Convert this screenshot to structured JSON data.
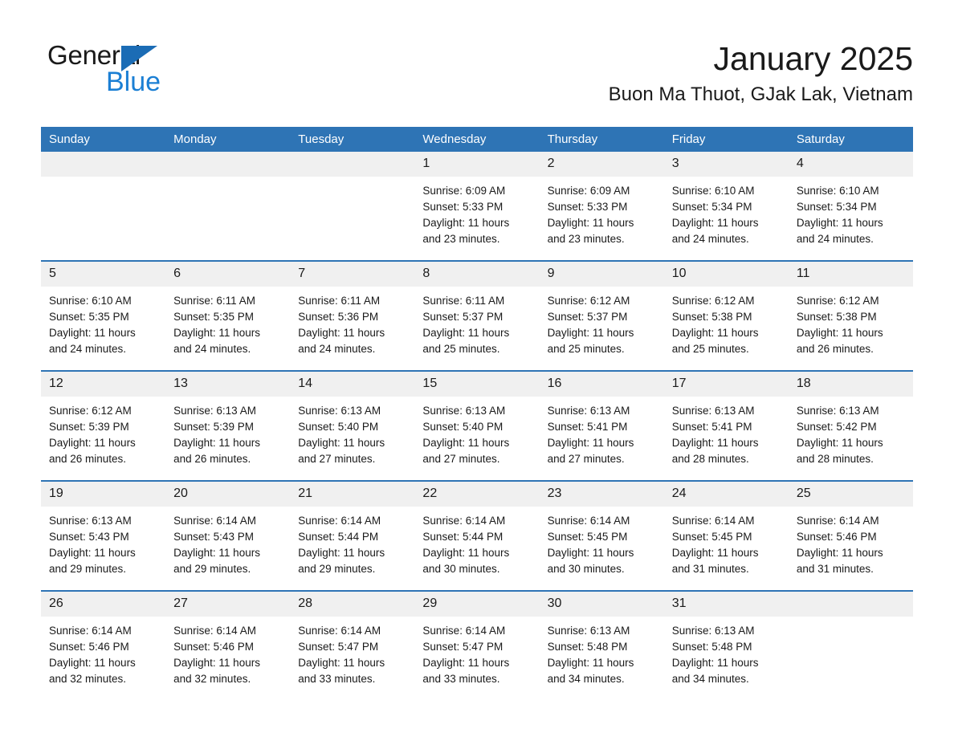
{
  "logo": {
    "word1": "General",
    "word2": "Blue",
    "triangle_color": "#1b6cb5",
    "blue_color": "#1b7fd4"
  },
  "header": {
    "month_year": "January 2025",
    "location": "Buon Ma Thuot, GJak Lak, Vietnam"
  },
  "theme": {
    "header_blue": "#2e74b5",
    "daynum_gray": "#f0f0f0",
    "text": "#1a1a1a"
  },
  "weekdays": [
    "Sunday",
    "Monday",
    "Tuesday",
    "Wednesday",
    "Thursday",
    "Friday",
    "Saturday"
  ],
  "weeks": [
    [
      {
        "day": "",
        "empty": true
      },
      {
        "day": "",
        "empty": true
      },
      {
        "day": "",
        "empty": true
      },
      {
        "day": "1",
        "sunrise": "Sunrise: 6:09 AM",
        "sunset": "Sunset: 5:33 PM",
        "daylight1": "Daylight: 11 hours",
        "daylight2": "and 23 minutes."
      },
      {
        "day": "2",
        "sunrise": "Sunrise: 6:09 AM",
        "sunset": "Sunset: 5:33 PM",
        "daylight1": "Daylight: 11 hours",
        "daylight2": "and 23 minutes."
      },
      {
        "day": "3",
        "sunrise": "Sunrise: 6:10 AM",
        "sunset": "Sunset: 5:34 PM",
        "daylight1": "Daylight: 11 hours",
        "daylight2": "and 24 minutes."
      },
      {
        "day": "4",
        "sunrise": "Sunrise: 6:10 AM",
        "sunset": "Sunset: 5:34 PM",
        "daylight1": "Daylight: 11 hours",
        "daylight2": "and 24 minutes."
      }
    ],
    [
      {
        "day": "5",
        "sunrise": "Sunrise: 6:10 AM",
        "sunset": "Sunset: 5:35 PM",
        "daylight1": "Daylight: 11 hours",
        "daylight2": "and 24 minutes."
      },
      {
        "day": "6",
        "sunrise": "Sunrise: 6:11 AM",
        "sunset": "Sunset: 5:35 PM",
        "daylight1": "Daylight: 11 hours",
        "daylight2": "and 24 minutes."
      },
      {
        "day": "7",
        "sunrise": "Sunrise: 6:11 AM",
        "sunset": "Sunset: 5:36 PM",
        "daylight1": "Daylight: 11 hours",
        "daylight2": "and 24 minutes."
      },
      {
        "day": "8",
        "sunrise": "Sunrise: 6:11 AM",
        "sunset": "Sunset: 5:37 PM",
        "daylight1": "Daylight: 11 hours",
        "daylight2": "and 25 minutes."
      },
      {
        "day": "9",
        "sunrise": "Sunrise: 6:12 AM",
        "sunset": "Sunset: 5:37 PM",
        "daylight1": "Daylight: 11 hours",
        "daylight2": "and 25 minutes."
      },
      {
        "day": "10",
        "sunrise": "Sunrise: 6:12 AM",
        "sunset": "Sunset: 5:38 PM",
        "daylight1": "Daylight: 11 hours",
        "daylight2": "and 25 minutes."
      },
      {
        "day": "11",
        "sunrise": "Sunrise: 6:12 AM",
        "sunset": "Sunset: 5:38 PM",
        "daylight1": "Daylight: 11 hours",
        "daylight2": "and 26 minutes."
      }
    ],
    [
      {
        "day": "12",
        "sunrise": "Sunrise: 6:12 AM",
        "sunset": "Sunset: 5:39 PM",
        "daylight1": "Daylight: 11 hours",
        "daylight2": "and 26 minutes."
      },
      {
        "day": "13",
        "sunrise": "Sunrise: 6:13 AM",
        "sunset": "Sunset: 5:39 PM",
        "daylight1": "Daylight: 11 hours",
        "daylight2": "and 26 minutes."
      },
      {
        "day": "14",
        "sunrise": "Sunrise: 6:13 AM",
        "sunset": "Sunset: 5:40 PM",
        "daylight1": "Daylight: 11 hours",
        "daylight2": "and 27 minutes."
      },
      {
        "day": "15",
        "sunrise": "Sunrise: 6:13 AM",
        "sunset": "Sunset: 5:40 PM",
        "daylight1": "Daylight: 11 hours",
        "daylight2": "and 27 minutes."
      },
      {
        "day": "16",
        "sunrise": "Sunrise: 6:13 AM",
        "sunset": "Sunset: 5:41 PM",
        "daylight1": "Daylight: 11 hours",
        "daylight2": "and 27 minutes."
      },
      {
        "day": "17",
        "sunrise": "Sunrise: 6:13 AM",
        "sunset": "Sunset: 5:41 PM",
        "daylight1": "Daylight: 11 hours",
        "daylight2": "and 28 minutes."
      },
      {
        "day": "18",
        "sunrise": "Sunrise: 6:13 AM",
        "sunset": "Sunset: 5:42 PM",
        "daylight1": "Daylight: 11 hours",
        "daylight2": "and 28 minutes."
      }
    ],
    [
      {
        "day": "19",
        "sunrise": "Sunrise: 6:13 AM",
        "sunset": "Sunset: 5:43 PM",
        "daylight1": "Daylight: 11 hours",
        "daylight2": "and 29 minutes."
      },
      {
        "day": "20",
        "sunrise": "Sunrise: 6:14 AM",
        "sunset": "Sunset: 5:43 PM",
        "daylight1": "Daylight: 11 hours",
        "daylight2": "and 29 minutes."
      },
      {
        "day": "21",
        "sunrise": "Sunrise: 6:14 AM",
        "sunset": "Sunset: 5:44 PM",
        "daylight1": "Daylight: 11 hours",
        "daylight2": "and 29 minutes."
      },
      {
        "day": "22",
        "sunrise": "Sunrise: 6:14 AM",
        "sunset": "Sunset: 5:44 PM",
        "daylight1": "Daylight: 11 hours",
        "daylight2": "and 30 minutes."
      },
      {
        "day": "23",
        "sunrise": "Sunrise: 6:14 AM",
        "sunset": "Sunset: 5:45 PM",
        "daylight1": "Daylight: 11 hours",
        "daylight2": "and 30 minutes."
      },
      {
        "day": "24",
        "sunrise": "Sunrise: 6:14 AM",
        "sunset": "Sunset: 5:45 PM",
        "daylight1": "Daylight: 11 hours",
        "daylight2": "and 31 minutes."
      },
      {
        "day": "25",
        "sunrise": "Sunrise: 6:14 AM",
        "sunset": "Sunset: 5:46 PM",
        "daylight1": "Daylight: 11 hours",
        "daylight2": "and 31 minutes."
      }
    ],
    [
      {
        "day": "26",
        "sunrise": "Sunrise: 6:14 AM",
        "sunset": "Sunset: 5:46 PM",
        "daylight1": "Daylight: 11 hours",
        "daylight2": "and 32 minutes."
      },
      {
        "day": "27",
        "sunrise": "Sunrise: 6:14 AM",
        "sunset": "Sunset: 5:46 PM",
        "daylight1": "Daylight: 11 hours",
        "daylight2": "and 32 minutes."
      },
      {
        "day": "28",
        "sunrise": "Sunrise: 6:14 AM",
        "sunset": "Sunset: 5:47 PM",
        "daylight1": "Daylight: 11 hours",
        "daylight2": "and 33 minutes."
      },
      {
        "day": "29",
        "sunrise": "Sunrise: 6:14 AM",
        "sunset": "Sunset: 5:47 PM",
        "daylight1": "Daylight: 11 hours",
        "daylight2": "and 33 minutes."
      },
      {
        "day": "30",
        "sunrise": "Sunrise: 6:13 AM",
        "sunset": "Sunset: 5:48 PM",
        "daylight1": "Daylight: 11 hours",
        "daylight2": "and 34 minutes."
      },
      {
        "day": "31",
        "sunrise": "Sunrise: 6:13 AM",
        "sunset": "Sunset: 5:48 PM",
        "daylight1": "Daylight: 11 hours",
        "daylight2": "and 34 minutes."
      },
      {
        "day": "",
        "empty": true
      }
    ]
  ]
}
